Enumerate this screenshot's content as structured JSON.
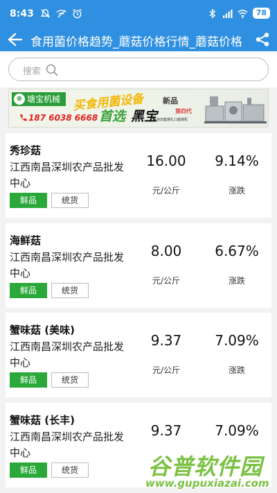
{
  "status": {
    "time": "8:43",
    "battery": "78",
    "icons": [
      "mute-icon",
      "wifi-off-icon",
      "alarm-icon",
      "bluetooth-icon",
      "signal-icon",
      "wifi-icon"
    ]
  },
  "appbar": {
    "title": "食用菌价格趋势_蘑菇价格行情_蘑菇价格",
    "icons": [
      "back-arrow-icon",
      "share-icon"
    ]
  },
  "search": {
    "placeholder": "搜索"
  },
  "banner": {
    "brand": "塘宝机械",
    "phone": "187 6038 6668",
    "slogan_a": "买食用菌设备",
    "slogan_b": "首选",
    "slogan_c": "黑宝",
    "new_product": "新品",
    "generation": "第四代",
    "description": "全自动套袋扎口装袋机"
  },
  "accent": "#2f8fe0",
  "tag_color": "#2aa93a",
  "rows": [
    {
      "name": "秀珍菇",
      "market": "江西南昌深圳农产品批发中心",
      "tag1": "鲜品",
      "tag2": "统货",
      "price": "16.00",
      "unit": "元/公斤",
      "change": "9.14%",
      "change_label": "涨跌"
    },
    {
      "name": "海鲜菇",
      "market": "江西南昌深圳农产品批发中心",
      "tag1": "鲜品",
      "tag2": "统货",
      "price": "8.00",
      "unit": "元/公斤",
      "change": "6.67%",
      "change_label": "涨跌"
    },
    {
      "name": "蟹味菇 (美味)",
      "market": "江西南昌深圳农产品批发中心",
      "tag1": "鲜品",
      "tag2": "统货",
      "price": "9.37",
      "unit": "元/公斤",
      "change": "7.09%",
      "change_label": "涨跌"
    },
    {
      "name": "蟹味菇 (长丰)",
      "market": "江西南昌深圳农产品批发中心",
      "tag1": "鲜品",
      "tag2": "统货",
      "price": "9.37",
      "unit": "",
      "change": "7.09%",
      "change_label": ""
    }
  ],
  "watermark": {
    "line1": "谷普软件园",
    "line2": "www.gupuxiazai.com"
  }
}
